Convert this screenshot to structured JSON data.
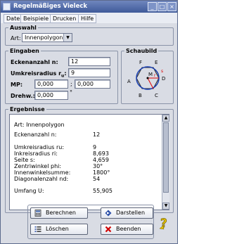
{
  "window": {
    "title": "Regelmäßiges Vieleck"
  },
  "menu": [
    "Datei",
    "Beispiele",
    "Drucken",
    "Hilfe"
  ],
  "auswahl": {
    "legend": "Auswahl",
    "label": "Art:",
    "selected": "Innenpolygon"
  },
  "eingaben": {
    "legend": "Eingaben",
    "eckenanzahl": {
      "label": "Eckenanzahl n:",
      "value": "12"
    },
    "umkreisradius": {
      "label": "Umkreisradius r",
      "sub": "u",
      "suffix": ":",
      "value": "9"
    },
    "mp": {
      "label": "MP:",
      "x": "0,000",
      "sep": ";",
      "y": "0,000"
    },
    "drehw": {
      "label": "Drehw.:",
      "value": "0,000",
      "unit": "°"
    }
  },
  "schaubild": {
    "legend": "Schaubild",
    "labels": [
      "F",
      "E",
      "M",
      "D",
      "A",
      "B",
      "C",
      "r",
      "s"
    ]
  },
  "ergebnisse": {
    "legend": "Ergebnisse",
    "rows": [
      {
        "label": "Art: Innenpolygon",
        "value": ""
      },
      {
        "label": "Eckenanzahl n:",
        "value": "12"
      },
      {
        "label": "Umkreisradius ru:",
        "value": "9"
      },
      {
        "label": "Inkreisradius ri:",
        "value": "8,693"
      },
      {
        "label": "Seite s:",
        "value": "4,659"
      },
      {
        "label": "Zentriwinkel phi:",
        "value": "30°"
      },
      {
        "label": "Innenwinkelsumme:",
        "value": "1800°"
      },
      {
        "label": "Diagonalenzahl nd:",
        "value": "54"
      },
      {
        "label": "Umfang U:",
        "value": "55,905"
      }
    ]
  },
  "buttons": {
    "berechnen": "Berechnen",
    "darstellen": "Darstellen",
    "loeschen": "Löschen",
    "beenden": "Beenden"
  },
  "icons": {
    "app": "app-window-icon",
    "calc": "calculator-icon",
    "plot": "diamond-arrow-icon",
    "clear": "list-clear-icon",
    "close": "red-x-icon",
    "help": "yellow-question-icon"
  },
  "colors": {
    "titlebar": "#3f5a9a",
    "window_bg": "#d9dce4",
    "circle": "#1a3fb0",
    "radius": "#e00000"
  }
}
